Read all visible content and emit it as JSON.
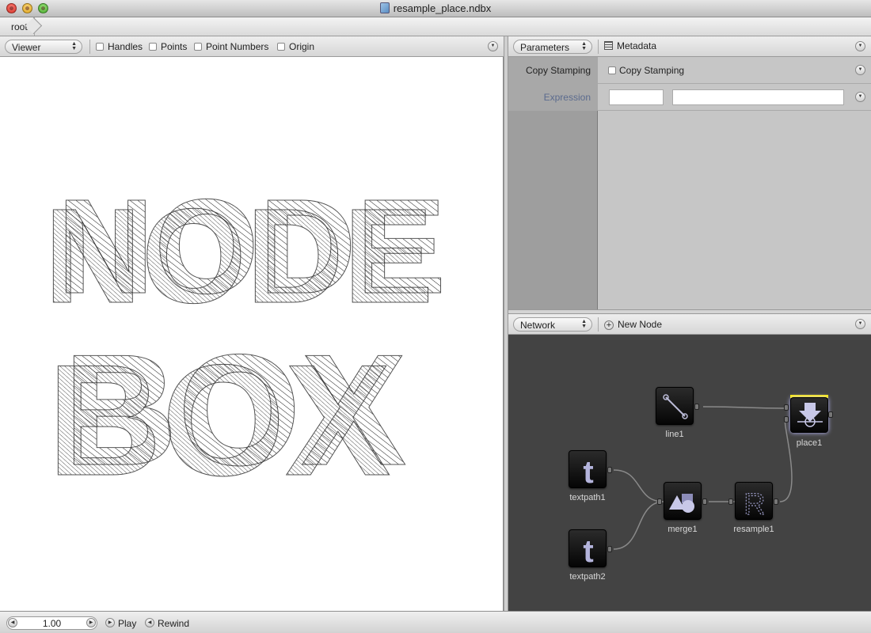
{
  "window": {
    "title": "resample_place.ndbx"
  },
  "breadcrumb": {
    "root": "root"
  },
  "viewer": {
    "mode": "Viewer",
    "options": [
      {
        "label": "Handles",
        "checked": false
      },
      {
        "label": "Points",
        "checked": false
      },
      {
        "label": "Point Numbers",
        "checked": false
      },
      {
        "label": "Origin",
        "checked": false
      }
    ],
    "canvas_text": [
      "NODE",
      "BOX"
    ]
  },
  "parameters": {
    "mode": "Parameters",
    "metadata_label": "Metadata",
    "rows": [
      {
        "label": "Copy Stamping",
        "control_label": "Copy Stamping",
        "checked": false
      },
      {
        "label": "Expression",
        "value1": "",
        "value2": ""
      }
    ]
  },
  "network": {
    "mode": "Network",
    "new_node_label": "New Node",
    "nodes": [
      {
        "name": "line1",
        "icon": "line-icon"
      },
      {
        "name": "place1",
        "icon": "place-icon",
        "rendered": true
      },
      {
        "name": "textpath1",
        "icon": "text-icon"
      },
      {
        "name": "merge1",
        "icon": "merge-icon"
      },
      {
        "name": "resample1",
        "icon": "resample-icon"
      },
      {
        "name": "textpath2",
        "icon": "text-icon"
      }
    ],
    "rendered_color": "#ffee00"
  },
  "playback": {
    "frame": "1.00",
    "play_label": "Play",
    "rewind_label": "Rewind"
  }
}
